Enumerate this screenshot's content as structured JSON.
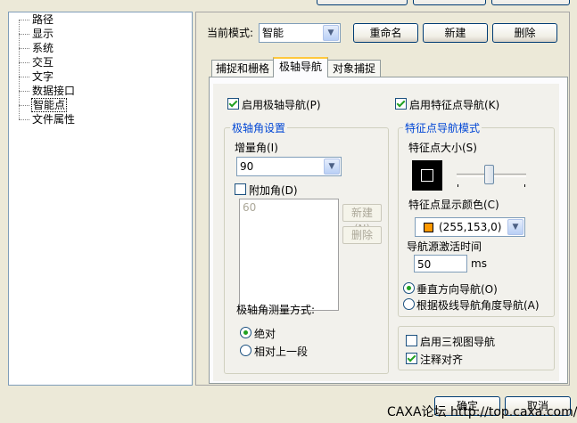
{
  "tree": {
    "items": [
      {
        "label": "路径"
      },
      {
        "label": "显示"
      },
      {
        "label": "系统"
      },
      {
        "label": "交互"
      },
      {
        "label": "文字"
      },
      {
        "label": "数据接口"
      },
      {
        "label": "智能点"
      },
      {
        "label": "文件属性"
      }
    ],
    "selected_index": 6
  },
  "mode": {
    "label": "当前模式:",
    "value": "智能",
    "rename_button": "重命名",
    "new_button": "新建",
    "delete_button": "删除"
  },
  "tabs": [
    {
      "label": "捕捉和栅格"
    },
    {
      "label": "极轴导航"
    },
    {
      "label": "对象捕捉"
    }
  ],
  "active_tab": 1,
  "polar": {
    "enable_label": "启用极轴导航(P)",
    "enable_checked": true,
    "group_title": "极轴角设置",
    "increment_label": "增量角(I)",
    "increment_value": "90",
    "additional_label": "附加角(D)",
    "additional_checked": false,
    "additional_list": [
      "60"
    ],
    "new_button": "新建(N)",
    "delete_button": "删除",
    "measure_label": "极轴角测量方式:",
    "measure_options": [
      "绝对",
      "相对上一段"
    ],
    "measure_selected": 0
  },
  "feature": {
    "enable_label": "启用特征点导航(K)",
    "enable_checked": true,
    "group_title": "特征点导航模式",
    "size_label": "特征点大小(S)",
    "size_slider_fraction": 0.4,
    "color_label": "特征点显示颜色(C)",
    "color_value": "(255,153,0)",
    "color_swatch": "#ff9900",
    "activation_label": "导航源激活时间",
    "activation_value": "50",
    "activation_unit": "ms",
    "direction_options": [
      "垂直方向导航(O)",
      "根据极线导航角度导航(A)"
    ],
    "direction_selected": 0
  },
  "extra": {
    "three_view_label": "启用三视图导航",
    "three_view_checked": false,
    "annotation_label": "注释对齐",
    "annotation_checked": true
  },
  "footer": {
    "ok_button": "确定",
    "cancel_button": "取消",
    "watermark": "CAXA论坛 http://top.caxa.com/"
  }
}
